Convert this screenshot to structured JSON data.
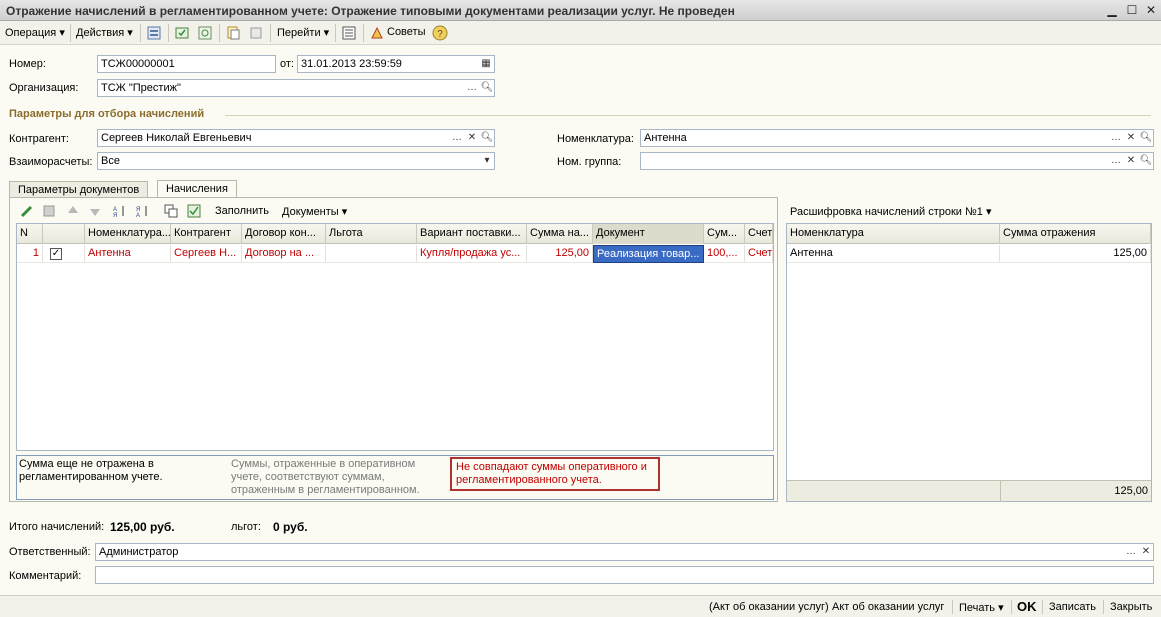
{
  "window": {
    "title": "Отражение начислений в регламентированном учете: Отражение типовыми документами реализации услуг. Не проведен"
  },
  "toolbar": {
    "operation": "Операция",
    "actions": "Действия",
    "goto": "Перейти",
    "tips": "Советы"
  },
  "header": {
    "number_label": "Номер:",
    "number_value": "ТСЖ00000001",
    "date_label": "от:",
    "date_value": "31.01.2013 23:59:59",
    "org_label": "Организация:",
    "org_value": "ТСЖ \"Престиж\""
  },
  "filters": {
    "title": "Параметры для отбора начислений",
    "counterparty_label": "Контрагент:",
    "counterparty_value": "Сергеев Николай Евгеньевич",
    "settlements_label": "Взаиморасчеты:",
    "settlements_value": "Все",
    "nomenclature_label": "Номенклатура:",
    "nomenclature_value": "Антенна",
    "nomgroup_label": "Ном. группа:",
    "nomgroup_value": ""
  },
  "tabs": {
    "params": "Параметры документов",
    "accruals": "Начисления"
  },
  "grid_toolbar": {
    "fill": "Заполнить",
    "documents": "Документы"
  },
  "grid": {
    "columns": [
      "N",
      "",
      "Номенклатура...",
      "Контрагент",
      "Договор кон...",
      "Льгота",
      "Вариант поставки...",
      "Сумма на...",
      "Документ",
      "Сум...",
      "Счет..."
    ],
    "row": {
      "n": "1",
      "nomenclature": "Антенна",
      "counterparty": "Сергеев Н...",
      "contract": "Договор на ...",
      "benefit": "",
      "variant": "Купля/продажа ус...",
      "sum": "125,00",
      "document": "Реализация товар...",
      "sum2": "100,...",
      "account": "Счет..."
    }
  },
  "legend": {
    "not_reflected": "Сумма еще не отражена в регламентированном учете.",
    "matched": "Суммы, отраженные в оперативном учете, соответствуют суммам, отраженным в регламентированном.",
    "mismatch": "Не совпадают суммы оперативного и регламентированного учета."
  },
  "detail": {
    "title": "Расшифровка начислений строки №1",
    "col_nomenclature": "Номенклатура",
    "col_sum": "Сумма отражения",
    "row_nomenclature": "Антенна",
    "row_sum": "125,00",
    "total": "125,00"
  },
  "totals": {
    "accruals_label": "Итого начислений:",
    "accruals_value": "125,00 руб.",
    "benefits_label": "льгот:",
    "benefits_value": "0 руб."
  },
  "footer_fields": {
    "responsible_label": "Ответственный:",
    "responsible_value": "Администратор",
    "comment_label": "Комментарий:",
    "comment_value": ""
  },
  "statusbar": {
    "act_paren": "(Акт об оказании услуг)",
    "act": "Акт об оказании услуг",
    "print": "Печать",
    "ok": "OK",
    "save": "Записать",
    "close": "Закрыть"
  }
}
